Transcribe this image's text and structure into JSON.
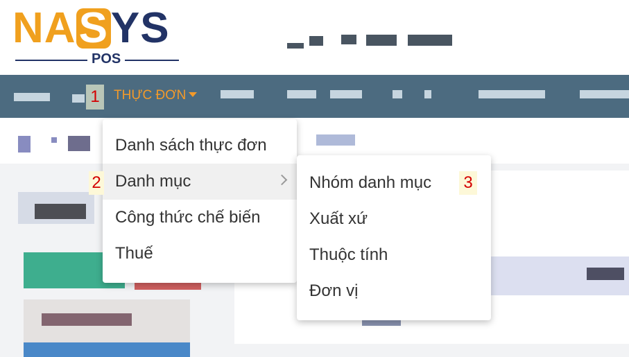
{
  "logo": {
    "part1": "NA",
    "part2": "S",
    "part3": "YS",
    "sub": "POS"
  },
  "navbar": {
    "annotation": "1",
    "menu_label": "THỰC ĐƠN"
  },
  "dropdown": {
    "items": [
      {
        "label": "Danh sách thực đơn"
      },
      {
        "label": "Danh mục"
      },
      {
        "label": "Công thức chế biến"
      },
      {
        "label": "Thuế"
      }
    ],
    "annotation": "2"
  },
  "submenu": {
    "items": [
      {
        "label": "Nhóm danh mục"
      },
      {
        "label": "Xuất xứ"
      },
      {
        "label": "Thuộc tính"
      },
      {
        "label": "Đơn vị"
      }
    ],
    "annotation": "3"
  },
  "colors": {
    "navbar": "#4c6b80",
    "accent": "#f39a2a",
    "annotation": "#d40000"
  }
}
